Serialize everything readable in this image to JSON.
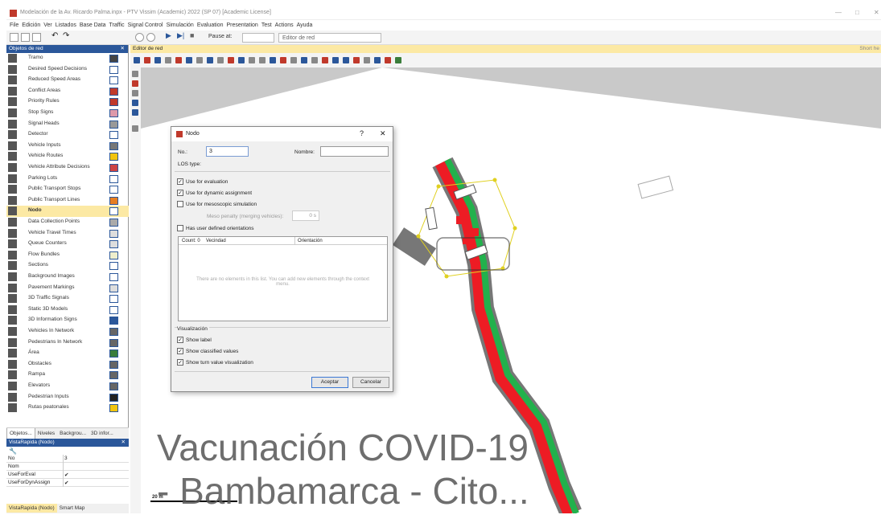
{
  "window": {
    "title": "Modelación de la Av. Ricardo Palma.inpx - PTV Vissim (Academic) 2022 (SP 07) [Academic License]",
    "controls": [
      "—",
      "□",
      "✕"
    ]
  },
  "menu": [
    "File",
    "Edición",
    "Ver",
    "Listados",
    "Base Data",
    "Traffic",
    "Signal Control",
    "Simulación",
    "Evaluation",
    "Presentation",
    "Test",
    "Actions",
    "Ayuda"
  ],
  "toolbar": {
    "pause_label": "Pause at:",
    "editor_combo": "Editor de red"
  },
  "left_panel": {
    "header": "Objetos de red",
    "items": [
      {
        "label": "Tramo",
        "color": "#444444"
      },
      {
        "label": "Desired Speed Decisions",
        "color": "#ffffff"
      },
      {
        "label": "Reduced Speed Areas",
        "color": "#ffffff"
      },
      {
        "label": "Conflict Areas",
        "color": "#c0392b"
      },
      {
        "label": "Priority Rules",
        "color": "#c0392b"
      },
      {
        "label": "Stop Signs",
        "color": "#d9a"
      },
      {
        "label": "Signal Heads",
        "color": "#999999"
      },
      {
        "label": "Detector",
        "color": "#ffffff"
      },
      {
        "label": "Vehicle Inputs",
        "color": "#777777"
      },
      {
        "label": "Vehicle Routes",
        "color": "#f1c40f"
      },
      {
        "label": "Vehicle Attribute Decisions",
        "color": "#cc4444"
      },
      {
        "label": "Parking Lots",
        "color": "#ffffff"
      },
      {
        "label": "Public Transport Stops",
        "color": "#ffffff"
      },
      {
        "label": "Public Transport Lines",
        "color": "#e67e22"
      },
      {
        "label": "Nodo",
        "color": "#ffffff"
      },
      {
        "label": "Data Collection Points",
        "color": "#aaaaaa"
      },
      {
        "label": "Vehicle Travel Times",
        "color": "#dddddd"
      },
      {
        "label": "Queue Counters",
        "color": "#dddddd"
      },
      {
        "label": "Flow Bundles",
        "color": "#eeeecc"
      },
      {
        "label": "Sections",
        "color": "#ffffff"
      },
      {
        "label": "Background Images",
        "color": "#ffffff"
      },
      {
        "label": "Pavement Markings",
        "color": "#dddddd"
      },
      {
        "label": "3D Traffic Signals",
        "color": "#ffffff"
      },
      {
        "label": "Static 3D Models",
        "color": "#ffffff"
      },
      {
        "label": "3D Information Signs",
        "color": "#2b579a"
      },
      {
        "label": "Vehicles In Network",
        "color": "#666666"
      },
      {
        "label": "Pedestrians In Network",
        "color": "#666666"
      },
      {
        "label": "Área",
        "color": "#3a7d3a"
      },
      {
        "label": "Obstacles",
        "color": "#666666"
      },
      {
        "label": "Rampa",
        "color": "#666666"
      },
      {
        "label": "Elevators",
        "color": "#666666"
      },
      {
        "label": "Pedestrian Inputs",
        "color": "#222222"
      },
      {
        "label": "Rutas peatonales",
        "color": "#f1c40f"
      }
    ],
    "selected_index": 14,
    "tabs": [
      "Objetos...",
      "Niveles",
      "Backgrou...",
      "3D infor..."
    ]
  },
  "quick_view": {
    "header": "VistaRapida (Nodo)",
    "rows": [
      {
        "key": "No",
        "value": "3"
      },
      {
        "key": "Nom",
        "value": ""
      },
      {
        "key": "UseForEval",
        "value": "✔"
      },
      {
        "key": "UseForDynAssign",
        "value": "✔"
      }
    ],
    "tabs": [
      "VistaRapida (Nodo)",
      "Smart Map"
    ]
  },
  "editor": {
    "header": "Editor de red",
    "short_help": "Short he",
    "scale_label": "20 m",
    "map_text_line1": "Vacunación COVID-19",
    "map_text_line2": "- Bambamarca - Cito..."
  },
  "dialog": {
    "title": "Nodo",
    "help_btn": "?",
    "close_btn": "✕",
    "no_label": "No.:",
    "no_value": "3",
    "name_label": "Nombre:",
    "name_value": "",
    "los_label": "LOS type:",
    "checks": [
      {
        "label": "Use for evaluation",
        "checked": true
      },
      {
        "label": "Use for dynamic assignment",
        "checked": true
      },
      {
        "label": "Use for mesoscopic simulation",
        "checked": false
      }
    ],
    "meso_penalty_label": "Meso penalty (merging vehicles):",
    "meso_penalty_value": "0 s",
    "orientations_label": "Has user defined orientations",
    "list_headers": [
      "Count: 0",
      "Vecindad",
      "Orientación"
    ],
    "list_empty": "There are no elements in this list. You can add new elements through the context menu.",
    "viz_label": "Visualización",
    "viz_checks": [
      {
        "label": "Show label",
        "checked": true
      },
      {
        "label": "Show classified values",
        "checked": true
      },
      {
        "label": "Show turn value visualization",
        "checked": true
      }
    ],
    "ok": "Aceptar",
    "cancel": "Cancelar"
  },
  "colors": {
    "accent": "#2b579a",
    "selected": "#fce9a4",
    "road_green": "#22b14c",
    "road_red": "#ed1c24"
  }
}
